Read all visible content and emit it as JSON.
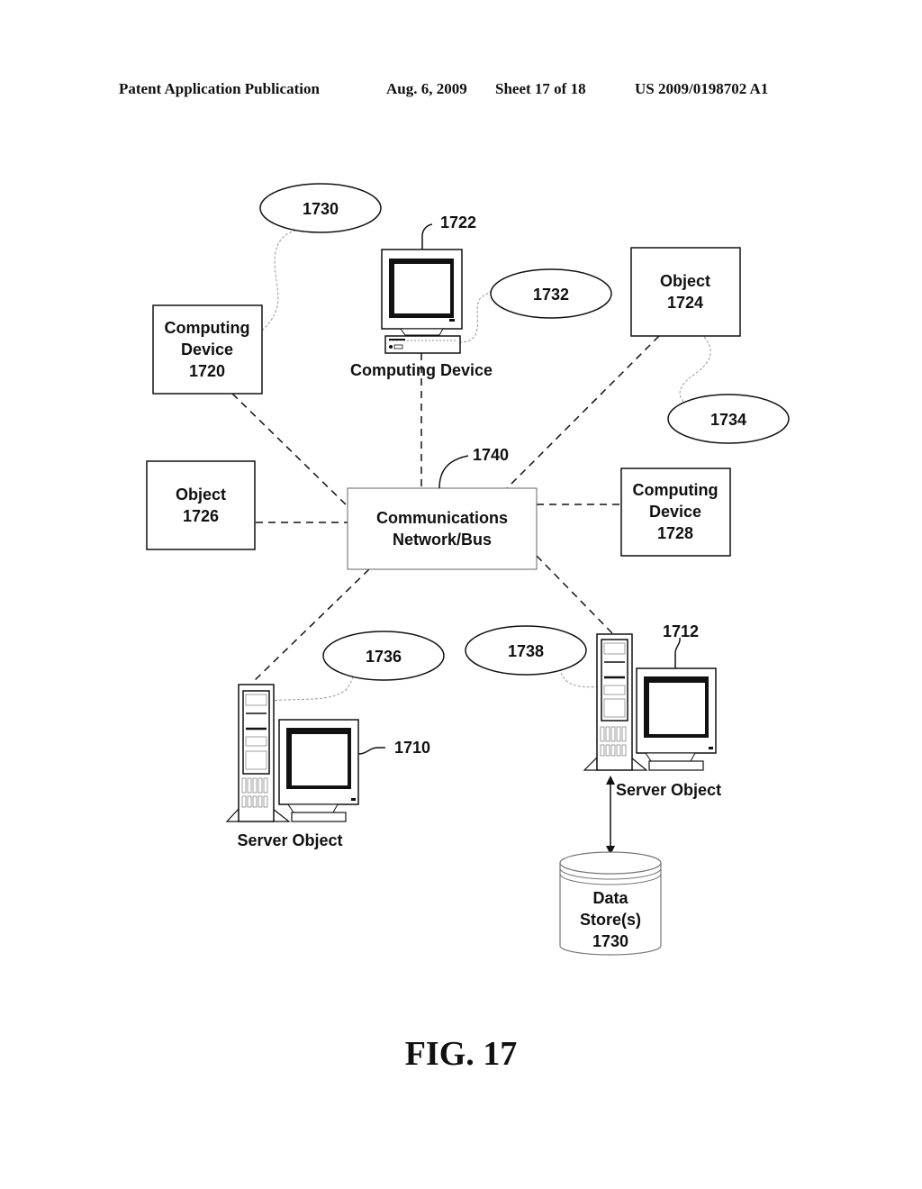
{
  "header": {
    "publication": "Patent Application Publication",
    "date": "Aug. 6, 2009",
    "sheet": "Sheet 17 of 18",
    "patent_number": "US 2009/0198702 A1"
  },
  "figure_label": "FIG. 17",
  "nodes": {
    "network": {
      "line1": "Communications",
      "line2": "Network/Bus",
      "ref": "1740"
    },
    "computing_device_1720": {
      "line1": "Computing",
      "line2": "Device",
      "line3": "1720"
    },
    "computing_device_1722": {
      "label": "Computing Device",
      "ref": "1722",
      "icon": "desktop-computer-icon"
    },
    "object_1724": {
      "line1": "Object",
      "line2": "1724"
    },
    "object_1726": {
      "line1": "Object",
      "line2": "1726"
    },
    "computing_device_1728": {
      "line1": "Computing",
      "line2": "Device",
      "line3": "1728"
    },
    "server_1710": {
      "label": "Server Object",
      "ref": "1710",
      "icon": "server-tower-icon"
    },
    "server_1712": {
      "label": "Server Object",
      "ref": "1712",
      "icon": "server-tower-icon"
    },
    "data_store": {
      "line1": "Data",
      "line2": "Store(s)",
      "line3": "1730",
      "icon": "database-cylinder-icon"
    }
  },
  "ellipses": {
    "e1730": "1730",
    "e1732": "1732",
    "e1734": "1734",
    "e1736": "1736",
    "e1738": "1738"
  }
}
